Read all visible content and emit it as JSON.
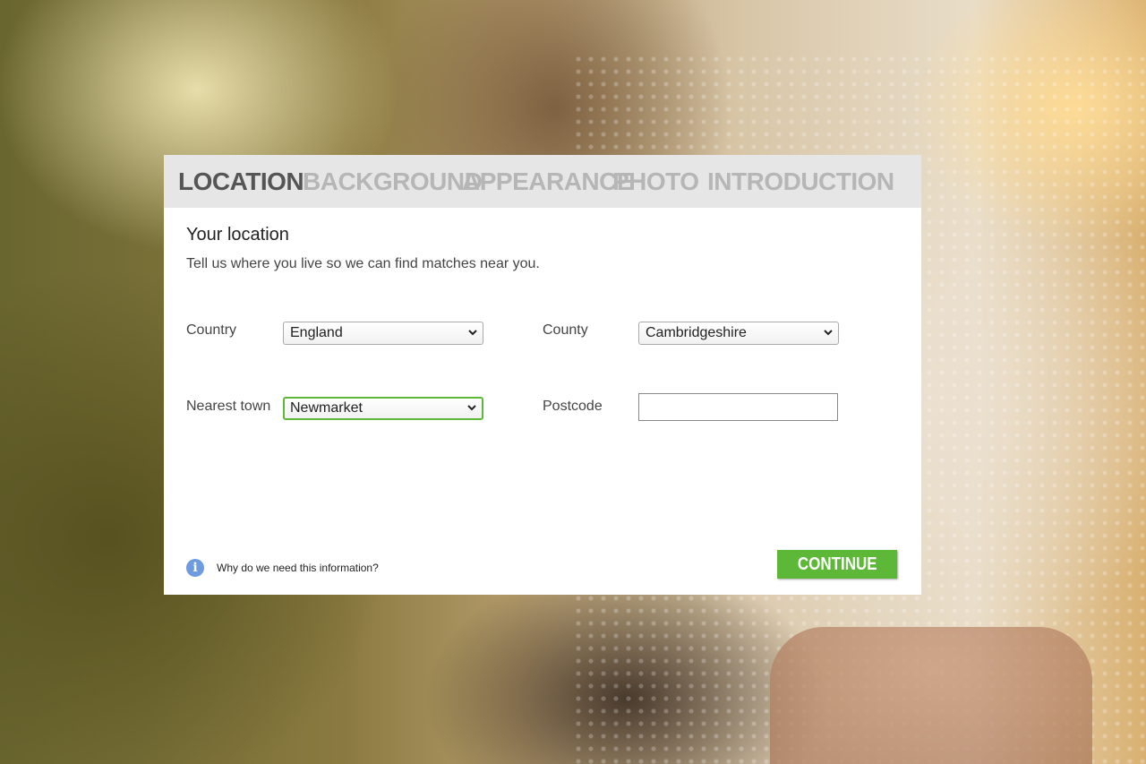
{
  "tabs": [
    {
      "label": "LOCATION",
      "active": true
    },
    {
      "label": "BACKGROUND",
      "active": false
    },
    {
      "label": "APPEARANCE",
      "active": false
    },
    {
      "label": "PHOTO",
      "active": false
    },
    {
      "label": "INTRODUCTION",
      "active": false
    }
  ],
  "form": {
    "title": "Your location",
    "subtitle": "Tell us where you live so we can find matches near you.",
    "country": {
      "label": "Country",
      "value": "England"
    },
    "county": {
      "label": "County",
      "value": "Cambridgeshire"
    },
    "town": {
      "label": "Nearest town",
      "value": "Newmarket"
    },
    "postcode": {
      "label": "Postcode",
      "value": ""
    }
  },
  "footer": {
    "info_text": "Why do we need this information?",
    "continue_label": "CONTINUE"
  },
  "colors": {
    "accent_green": "#5cb836",
    "tab_active": "#555555",
    "tab_inactive": "#b6b6b6",
    "info_blue": "#6f9be0"
  }
}
